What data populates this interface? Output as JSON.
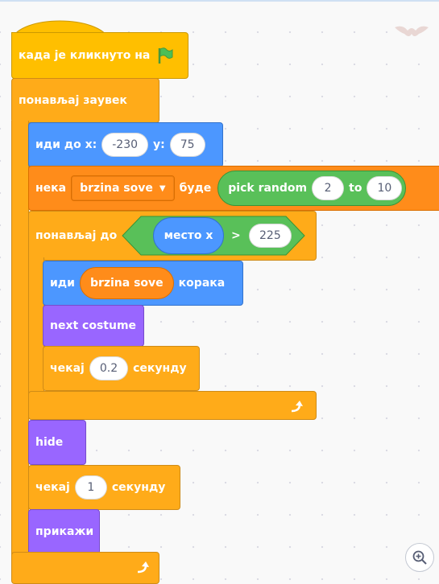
{
  "event_block": {
    "label": "када је кликнуто на",
    "icon": "green-flag-icon"
  },
  "forever_block": {
    "label": "понављај заувек"
  },
  "goto_block": {
    "prefix": "иди до x:",
    "x": "-230",
    "y_label": "y:",
    "y": "75"
  },
  "setvar_block": {
    "prefix": "нека",
    "variable": "brzina sove",
    "dropdown_icon": "▼",
    "middle": "буде",
    "random_label": "pick random",
    "from": "2",
    "to_label": "to",
    "to": "10"
  },
  "repeat_until_block": {
    "label": "понављај до",
    "reporter": "место x",
    "operator": ">",
    "value": "225"
  },
  "move_block": {
    "prefix": "иди",
    "reporter": "brzina sove",
    "suffix": "корака"
  },
  "next_costume_block": {
    "label": "next costume"
  },
  "wait_inner_block": {
    "prefix": "чекај",
    "value": "0.2",
    "suffix": "секунду"
  },
  "hide_block": {
    "label": "hide"
  },
  "wait_outer_block": {
    "prefix": "чекај",
    "value": "1",
    "suffix": "секунду"
  },
  "show_block": {
    "label": "прикажи"
  },
  "colors": {
    "events": "#ffbf00",
    "control": "#ffab19",
    "motion": "#4c97ff",
    "looks": "#9966ff",
    "variables": "#ff8c1a",
    "operators": "#59c059"
  },
  "icons": {
    "loop_end": "loop-arrow-icon",
    "zoom": "zoom-in-icon",
    "sprite": "bat-sprite-icon"
  }
}
